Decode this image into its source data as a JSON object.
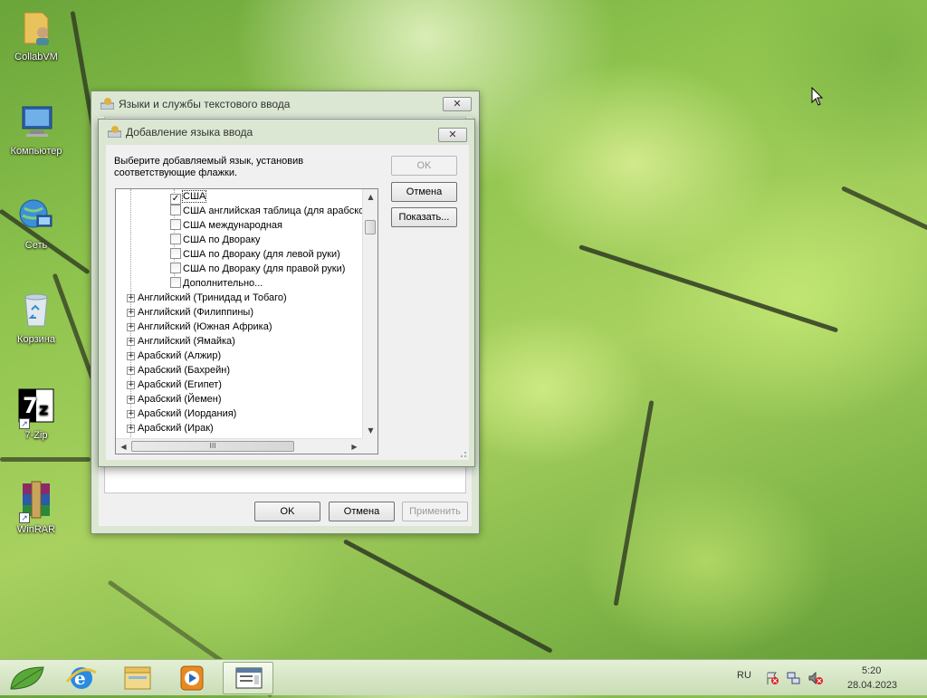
{
  "desktop": {
    "icons": [
      {
        "label": "CollabVM",
        "icon": "user-folder-icon"
      },
      {
        "label": "Компьютер",
        "icon": "computer-icon"
      },
      {
        "label": "Сеть",
        "icon": "network-globe-icon"
      },
      {
        "label": "Корзина",
        "icon": "recycle-bin-icon"
      },
      {
        "label": "7-Zip",
        "icon": "sevenzip-icon"
      },
      {
        "label": "WinRAR",
        "icon": "winrar-icon"
      }
    ]
  },
  "outer_dialog": {
    "title": "Языки и службы текстового ввода",
    "close_label": "✕",
    "ok_label": "OK",
    "cancel_label": "Отмена",
    "apply_label": "Применить"
  },
  "inner_dialog": {
    "title": "Добавление языка ввода",
    "close_label": "✕",
    "instruction": "Выберите добавляемый язык, установив соответствующие флажки.",
    "ok_label": "OK",
    "cancel_label": "Отмена",
    "preview_label": "Показать...",
    "tree_checked_items": [
      {
        "label": "США",
        "checked": true
      },
      {
        "label": "США английская таблица (для арабской",
        "checked": false
      },
      {
        "label": "США международная",
        "checked": false
      },
      {
        "label": "США по Двораку",
        "checked": false
      },
      {
        "label": "США по Двораку (для левой руки)",
        "checked": false
      },
      {
        "label": "США по Двораку (для правой руки)",
        "checked": false
      },
      {
        "label": "Дополнительно...",
        "checked": false
      }
    ],
    "tree_languages": [
      "Английский (Тринидад и Тобаго)",
      "Английский (Филиппины)",
      "Английский (Южная Африка)",
      "Английский (Ямайка)",
      "Арабский (Алжир)",
      "Арабский (Бахрейн)",
      "Арабский (Египет)",
      "Арабский (Йемен)",
      "Арабский (Иордания)",
      "Арабский (Ирак)"
    ],
    "hscroll_grip": "III"
  },
  "taskbar": {
    "items": [
      {
        "name": "start-button",
        "icon": "leaf-icon"
      },
      {
        "name": "internet-explorer",
        "icon": "ie-icon"
      },
      {
        "name": "file-explorer",
        "icon": "folder-icon"
      },
      {
        "name": "media-player",
        "icon": "media-player-icon"
      },
      {
        "name": "language-dialog-window",
        "icon": "dialog-window-icon",
        "active": true
      }
    ],
    "language": "RU",
    "time": "5:20",
    "date": "28.04.2023"
  }
}
